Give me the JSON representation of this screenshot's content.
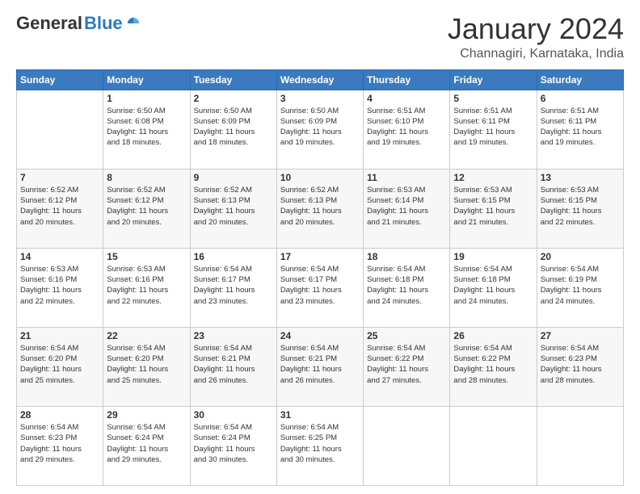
{
  "header": {
    "logo": {
      "general": "General",
      "blue": "Blue"
    },
    "title": "January 2024",
    "location": "Channagiri, Karnataka, India"
  },
  "calendar": {
    "days_of_week": [
      "Sunday",
      "Monday",
      "Tuesday",
      "Wednesday",
      "Thursday",
      "Friday",
      "Saturday"
    ],
    "weeks": [
      [
        {
          "day": "",
          "info": ""
        },
        {
          "day": "1",
          "info": "Sunrise: 6:50 AM\nSunset: 6:08 PM\nDaylight: 11 hours\nand 18 minutes."
        },
        {
          "day": "2",
          "info": "Sunrise: 6:50 AM\nSunset: 6:09 PM\nDaylight: 11 hours\nand 18 minutes."
        },
        {
          "day": "3",
          "info": "Sunrise: 6:50 AM\nSunset: 6:09 PM\nDaylight: 11 hours\nand 19 minutes."
        },
        {
          "day": "4",
          "info": "Sunrise: 6:51 AM\nSunset: 6:10 PM\nDaylight: 11 hours\nand 19 minutes."
        },
        {
          "day": "5",
          "info": "Sunrise: 6:51 AM\nSunset: 6:11 PM\nDaylight: 11 hours\nand 19 minutes."
        },
        {
          "day": "6",
          "info": "Sunrise: 6:51 AM\nSunset: 6:11 PM\nDaylight: 11 hours\nand 19 minutes."
        }
      ],
      [
        {
          "day": "7",
          "info": "Sunrise: 6:52 AM\nSunset: 6:12 PM\nDaylight: 11 hours\nand 20 minutes."
        },
        {
          "day": "8",
          "info": "Sunrise: 6:52 AM\nSunset: 6:12 PM\nDaylight: 11 hours\nand 20 minutes."
        },
        {
          "day": "9",
          "info": "Sunrise: 6:52 AM\nSunset: 6:13 PM\nDaylight: 11 hours\nand 20 minutes."
        },
        {
          "day": "10",
          "info": "Sunrise: 6:52 AM\nSunset: 6:13 PM\nDaylight: 11 hours\nand 20 minutes."
        },
        {
          "day": "11",
          "info": "Sunrise: 6:53 AM\nSunset: 6:14 PM\nDaylight: 11 hours\nand 21 minutes."
        },
        {
          "day": "12",
          "info": "Sunrise: 6:53 AM\nSunset: 6:15 PM\nDaylight: 11 hours\nand 21 minutes."
        },
        {
          "day": "13",
          "info": "Sunrise: 6:53 AM\nSunset: 6:15 PM\nDaylight: 11 hours\nand 22 minutes."
        }
      ],
      [
        {
          "day": "14",
          "info": "Sunrise: 6:53 AM\nSunset: 6:16 PM\nDaylight: 11 hours\nand 22 minutes."
        },
        {
          "day": "15",
          "info": "Sunrise: 6:53 AM\nSunset: 6:16 PM\nDaylight: 11 hours\nand 22 minutes."
        },
        {
          "day": "16",
          "info": "Sunrise: 6:54 AM\nSunset: 6:17 PM\nDaylight: 11 hours\nand 23 minutes."
        },
        {
          "day": "17",
          "info": "Sunrise: 6:54 AM\nSunset: 6:17 PM\nDaylight: 11 hours\nand 23 minutes."
        },
        {
          "day": "18",
          "info": "Sunrise: 6:54 AM\nSunset: 6:18 PM\nDaylight: 11 hours\nand 24 minutes."
        },
        {
          "day": "19",
          "info": "Sunrise: 6:54 AM\nSunset: 6:18 PM\nDaylight: 11 hours\nand 24 minutes."
        },
        {
          "day": "20",
          "info": "Sunrise: 6:54 AM\nSunset: 6:19 PM\nDaylight: 11 hours\nand 24 minutes."
        }
      ],
      [
        {
          "day": "21",
          "info": "Sunrise: 6:54 AM\nSunset: 6:20 PM\nDaylight: 11 hours\nand 25 minutes."
        },
        {
          "day": "22",
          "info": "Sunrise: 6:54 AM\nSunset: 6:20 PM\nDaylight: 11 hours\nand 25 minutes."
        },
        {
          "day": "23",
          "info": "Sunrise: 6:54 AM\nSunset: 6:21 PM\nDaylight: 11 hours\nand 26 minutes."
        },
        {
          "day": "24",
          "info": "Sunrise: 6:54 AM\nSunset: 6:21 PM\nDaylight: 11 hours\nand 26 minutes."
        },
        {
          "day": "25",
          "info": "Sunrise: 6:54 AM\nSunset: 6:22 PM\nDaylight: 11 hours\nand 27 minutes."
        },
        {
          "day": "26",
          "info": "Sunrise: 6:54 AM\nSunset: 6:22 PM\nDaylight: 11 hours\nand 28 minutes."
        },
        {
          "day": "27",
          "info": "Sunrise: 6:54 AM\nSunset: 6:23 PM\nDaylight: 11 hours\nand 28 minutes."
        }
      ],
      [
        {
          "day": "28",
          "info": "Sunrise: 6:54 AM\nSunset: 6:23 PM\nDaylight: 11 hours\nand 29 minutes."
        },
        {
          "day": "29",
          "info": "Sunrise: 6:54 AM\nSunset: 6:24 PM\nDaylight: 11 hours\nand 29 minutes."
        },
        {
          "day": "30",
          "info": "Sunrise: 6:54 AM\nSunset: 6:24 PM\nDaylight: 11 hours\nand 30 minutes."
        },
        {
          "day": "31",
          "info": "Sunrise: 6:54 AM\nSunset: 6:25 PM\nDaylight: 11 hours\nand 30 minutes."
        },
        {
          "day": "",
          "info": ""
        },
        {
          "day": "",
          "info": ""
        },
        {
          "day": "",
          "info": ""
        }
      ]
    ]
  }
}
